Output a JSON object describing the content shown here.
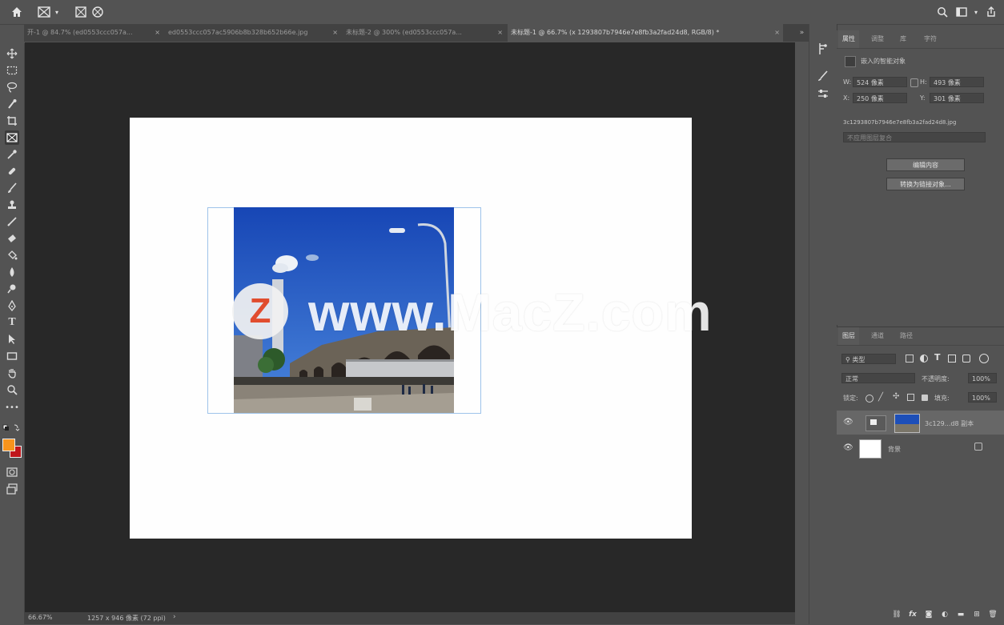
{
  "tabs": [
    {
      "label": "未标题-1 @ 66.7% (x 1293807b7946e7e8fb3a2fad24d8, RGB/8) *",
      "active": true
    },
    {
      "label": "开-1 @ 84.7% (ed0553ccc057a...",
      "active": false
    },
    {
      "label": "ed0553ccc057ac5906b8b328b652b66e.jpg",
      "active": false
    },
    {
      "label": "未标题-2 @ 300% (ed0553ccc057a...",
      "active": false
    }
  ],
  "properties": {
    "tabs": [
      "属性",
      "调整",
      "库",
      "字符"
    ],
    "object_type": "嵌入的智能对象",
    "w_label": "W:",
    "w_value": "524 像素",
    "h_label": "H:",
    "h_value": "493 像素",
    "x_label": "X:",
    "x_value": "250 像素",
    "y_label": "Y:",
    "y_value": "301 像素",
    "filename": "3c1293807b7946e7e8fb3a2fad24d8.jpg",
    "comp_placeholder": "不应用图层复合",
    "edit_button": "编辑内容",
    "convert_button": "转换为链接对象..."
  },
  "layers_panel": {
    "tabs": [
      "图层",
      "通道",
      "路径"
    ],
    "filter_kind": "类型",
    "blend_mode": "正常",
    "opacity_label": "不透明度:",
    "opacity_value": "100%",
    "lock_label": "锁定:",
    "fill_label": "填充:",
    "fill_value": "100%",
    "layers": [
      {
        "name": "3c129...d8 副本",
        "selected": true
      },
      {
        "name": "背景",
        "selected": false
      }
    ]
  },
  "watermark": {
    "logo_letter": "Z",
    "text": "www.MacZ.com"
  },
  "status": {
    "zoom": "66.67%",
    "doc_info": "1257 x 946 像素 (72 ppi)"
  },
  "colors": {
    "foreground": "#f7941d",
    "background": "#c0161b",
    "canvas_bg": "#282828",
    "selection": "#9ec3ea"
  }
}
